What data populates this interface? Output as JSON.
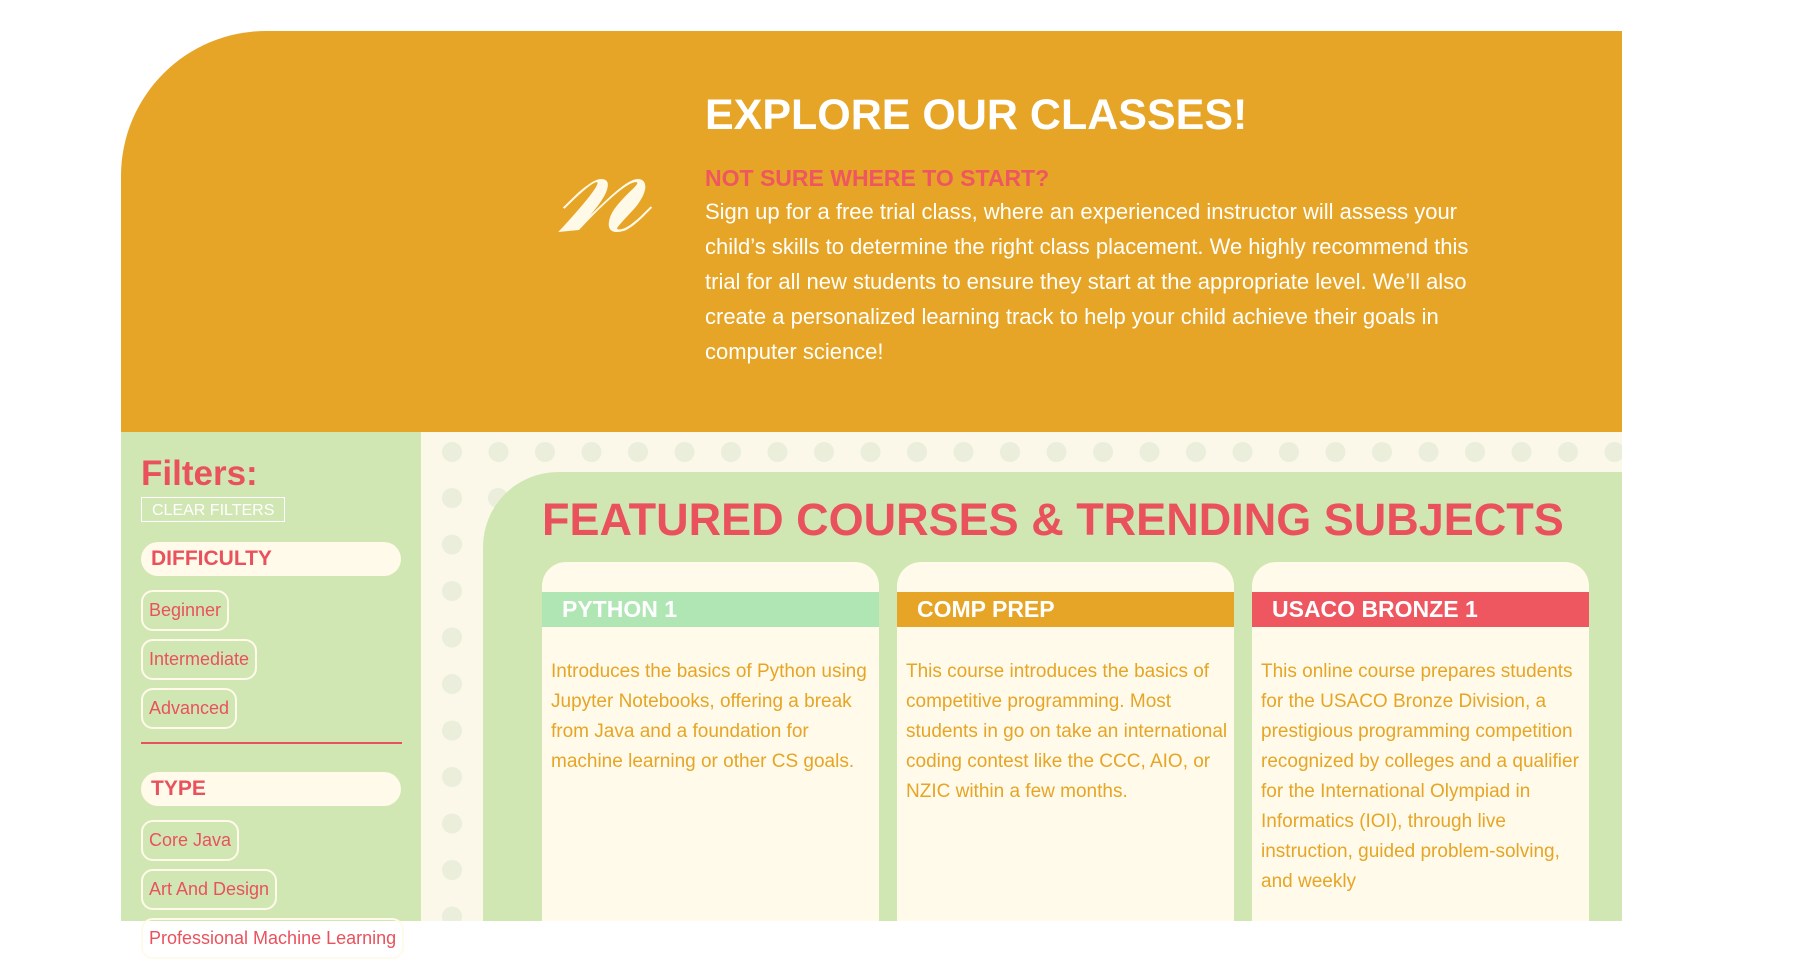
{
  "hero": {
    "logo_glyph": "𝓃",
    "title": "EXPLORE OUR CLASSES!",
    "subtitle": "NOT SURE WHERE TO START?",
    "text": "Sign up for a free trial class, where an experienced instructor will assess your child’s skills to determine the right class placement. We highly recommend this trial for all new students to ensure they start at the appropriate level. We’ll also create a personalized learning track to help your child achieve their goals in computer science!"
  },
  "sidebar": {
    "title": "Filters:",
    "clear_label": "CLEAR FILTERS",
    "difficulty": {
      "label": "DIFFICULTY",
      "options": [
        "Beginner",
        "Intermediate",
        "Advanced"
      ]
    },
    "type": {
      "label": "TYPE",
      "options": [
        "Core Java",
        "Art And Design",
        "Professional Machine Learning"
      ]
    }
  },
  "main": {
    "title": "FEATURED COURSES & TRENDING SUBJECTS",
    "cards": [
      {
        "title": "PYTHON 1",
        "color": "#B0E6B4",
        "text": "Introduces the basics of Python using Jupyter Notebooks, offering a break from Java and a foundation for machine learning or other CS goals."
      },
      {
        "title": "COMP PREP",
        "color": "#E6A526",
        "text": "This course introduces the basics of competitive programming. Most students in go on take an international coding contest like the CCC, AIO, or NZIC within a few months."
      },
      {
        "title": "USACO BRONZE 1",
        "color": "#EE5760",
        "text": "This online course prepares students for the USACO Bronze Division, a prestigious programming competition recognized by colleges and a qualifier for the International Olympiad in Informatics (IOI), through live instruction, guided problem-solving, and weekly"
      }
    ]
  },
  "colors": {
    "mustard": "#E6A526",
    "coral": "#E9525D",
    "sage": "#D1E7B3",
    "cream": "#FFFAE9"
  }
}
